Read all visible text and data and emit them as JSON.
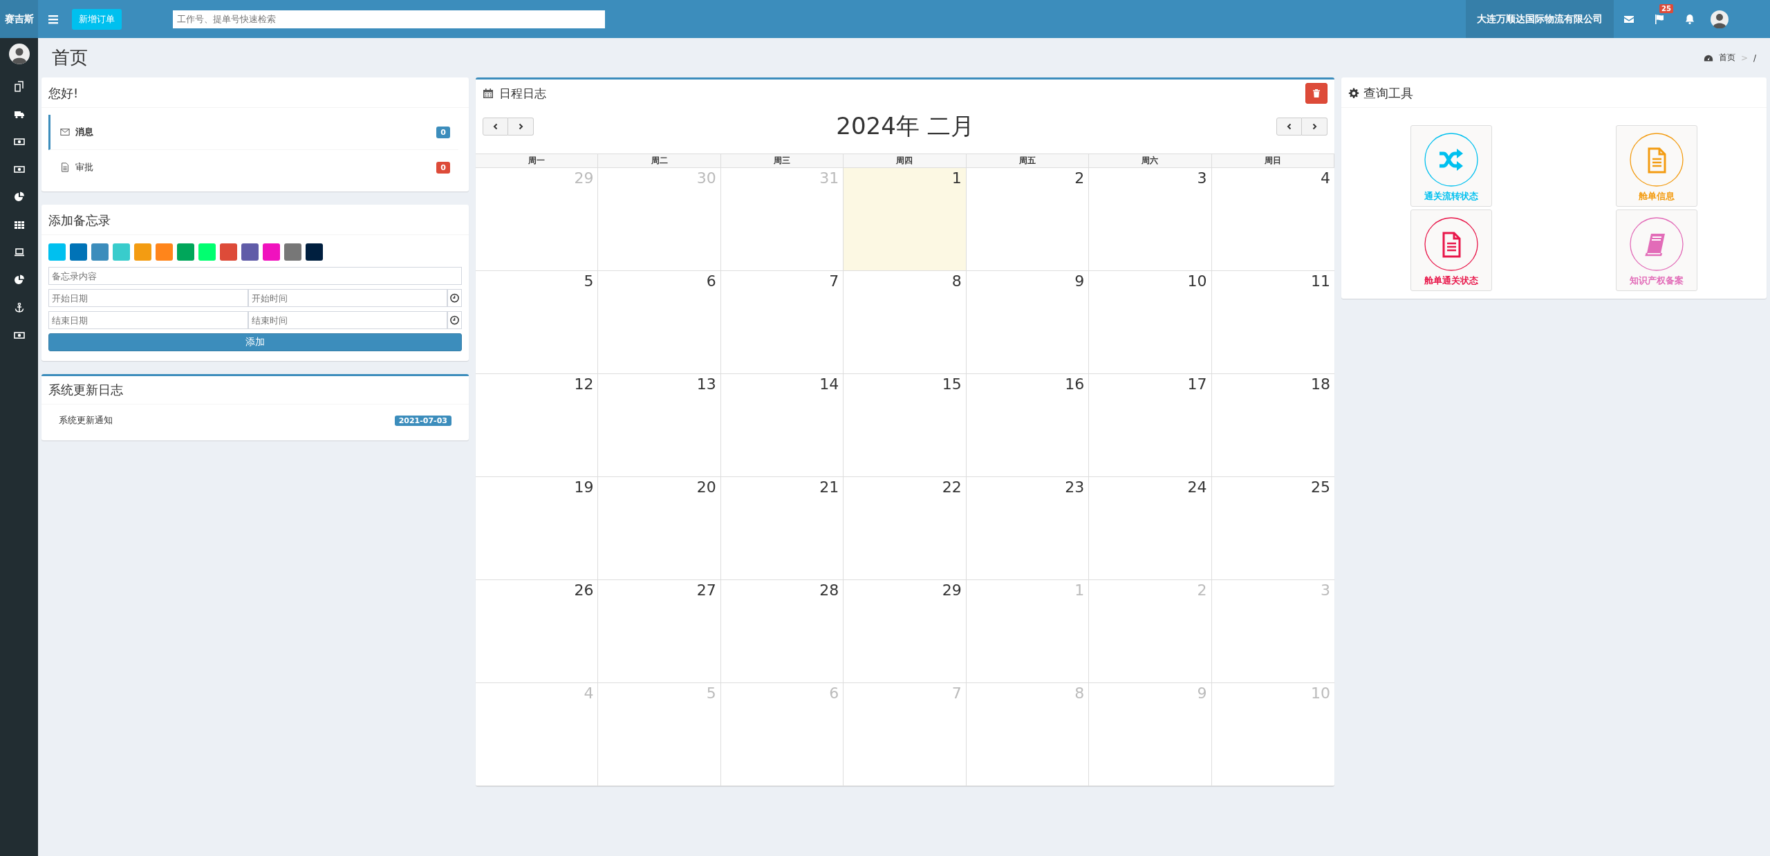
{
  "topbar": {
    "brand": "赛吉斯",
    "new_order_button": "新增订单",
    "search": {
      "placeholder": "工作号、提单号快速检索"
    },
    "company": "大连万顺达国际物流有限公司",
    "flag_badge": "25"
  },
  "sidebar": {
    "items": [
      {
        "kind": "copy"
      },
      {
        "kind": "truck"
      },
      {
        "kind": "money"
      },
      {
        "kind": "money"
      },
      {
        "kind": "pie"
      },
      {
        "kind": "grid"
      },
      {
        "kind": "laptop"
      },
      {
        "kind": "pie"
      },
      {
        "kind": "anchor"
      },
      {
        "kind": "money"
      }
    ]
  },
  "page_title": "首页",
  "breadcrumb": {
    "home": "首页",
    "separator": ">",
    "current": "/"
  },
  "greeting": {
    "title": "您好!",
    "items": [
      {
        "kind": "mail",
        "label": "消息",
        "count": "0",
        "color": "#3c8dbc",
        "selected": true
      },
      {
        "kind": "file",
        "label": "审批",
        "count": "0",
        "color": "#dd4b39",
        "selected": false
      }
    ]
  },
  "memo": {
    "title": "添加备忘录",
    "colors": [
      {
        "color": "#00c0ef"
      },
      {
        "color": "#0073b7"
      },
      {
        "color": "#3c8dbc"
      },
      {
        "color": "#39cccc"
      },
      {
        "color": "#f39c12"
      },
      {
        "color": "#ff851b"
      },
      {
        "color": "#00a65a"
      },
      {
        "color": "#01ff70"
      },
      {
        "color": "#dd4b39"
      },
      {
        "color": "#605ca8"
      },
      {
        "color": "#f012be"
      },
      {
        "color": "#777777"
      },
      {
        "color": "#001f3f"
      }
    ],
    "content": {
      "placeholder": "备忘录内容"
    },
    "start_date": {
      "placeholder": "开始日期"
    },
    "start_time": {
      "placeholder": "开始时间"
    },
    "end_date": {
      "placeholder": "结束日期"
    },
    "end_time": {
      "placeholder": "结束时间"
    },
    "add_button": "添加"
  },
  "update_log": {
    "title": "系统更新日志",
    "items": [
      {
        "text": "系统更新通知",
        "date": "2021-07-03"
      }
    ]
  },
  "calendar": {
    "title": "日程日志",
    "month": "2024年 二月",
    "weekdays": [
      "周一",
      "周二",
      "周三",
      "周四",
      "周五",
      "周六",
      "周日"
    ],
    "days": [
      {
        "day": "29",
        "muted": true,
        "today": false
      },
      {
        "day": "30",
        "muted": true,
        "today": false
      },
      {
        "day": "31",
        "muted": true,
        "today": false
      },
      {
        "day": "1",
        "muted": false,
        "today": true
      },
      {
        "day": "2",
        "muted": false,
        "today": false
      },
      {
        "day": "3",
        "muted": false,
        "today": false
      },
      {
        "day": "4",
        "muted": false,
        "today": false
      },
      {
        "day": "5",
        "muted": false,
        "today": false
      },
      {
        "day": "6",
        "muted": false,
        "today": false
      },
      {
        "day": "7",
        "muted": false,
        "today": false
      },
      {
        "day": "8",
        "muted": false,
        "today": false
      },
      {
        "day": "9",
        "muted": false,
        "today": false
      },
      {
        "day": "10",
        "muted": false,
        "today": false
      },
      {
        "day": "11",
        "muted": false,
        "today": false
      },
      {
        "day": "12",
        "muted": false,
        "today": false
      },
      {
        "day": "13",
        "muted": false,
        "today": false
      },
      {
        "day": "14",
        "muted": false,
        "today": false
      },
      {
        "day": "15",
        "muted": false,
        "today": false
      },
      {
        "day": "16",
        "muted": false,
        "today": false
      },
      {
        "day": "17",
        "muted": false,
        "today": false
      },
      {
        "day": "18",
        "muted": false,
        "today": false
      },
      {
        "day": "19",
        "muted": false,
        "today": false
      },
      {
        "day": "20",
        "muted": false,
        "today": false
      },
      {
        "day": "21",
        "muted": false,
        "today": false
      },
      {
        "day": "22",
        "muted": false,
        "today": false
      },
      {
        "day": "23",
        "muted": false,
        "today": false
      },
      {
        "day": "24",
        "muted": false,
        "today": false
      },
      {
        "day": "25",
        "muted": false,
        "today": false
      },
      {
        "day": "26",
        "muted": false,
        "today": false
      },
      {
        "day": "27",
        "muted": false,
        "today": false
      },
      {
        "day": "28",
        "muted": false,
        "today": false
      },
      {
        "day": "29",
        "muted": false,
        "today": false
      },
      {
        "day": "1",
        "muted": true,
        "today": false
      },
      {
        "day": "2",
        "muted": true,
        "today": false
      },
      {
        "day": "3",
        "muted": true,
        "today": false
      },
      {
        "day": "4",
        "muted": true,
        "today": false
      },
      {
        "day": "5",
        "muted": true,
        "today": false
      },
      {
        "day": "6",
        "muted": true,
        "today": false
      },
      {
        "day": "7",
        "muted": true,
        "today": false
      },
      {
        "day": "8",
        "muted": true,
        "today": false
      },
      {
        "day": "9",
        "muted": true,
        "today": false
      },
      {
        "day": "10",
        "muted": true,
        "today": false
      }
    ]
  },
  "tools": {
    "title": "查询工具",
    "items": [
      {
        "kind": "shuffle",
        "label": "通关流转状态",
        "color": "#00c0ef"
      },
      {
        "kind": "file",
        "label": "舱单信息",
        "color": "#f39c12"
      },
      {
        "kind": "file",
        "label": "舱单通关状态",
        "color": "#e8174a"
      },
      {
        "kind": "book",
        "label": "知识产权备案",
        "color": "#e26cb8"
      }
    ]
  }
}
